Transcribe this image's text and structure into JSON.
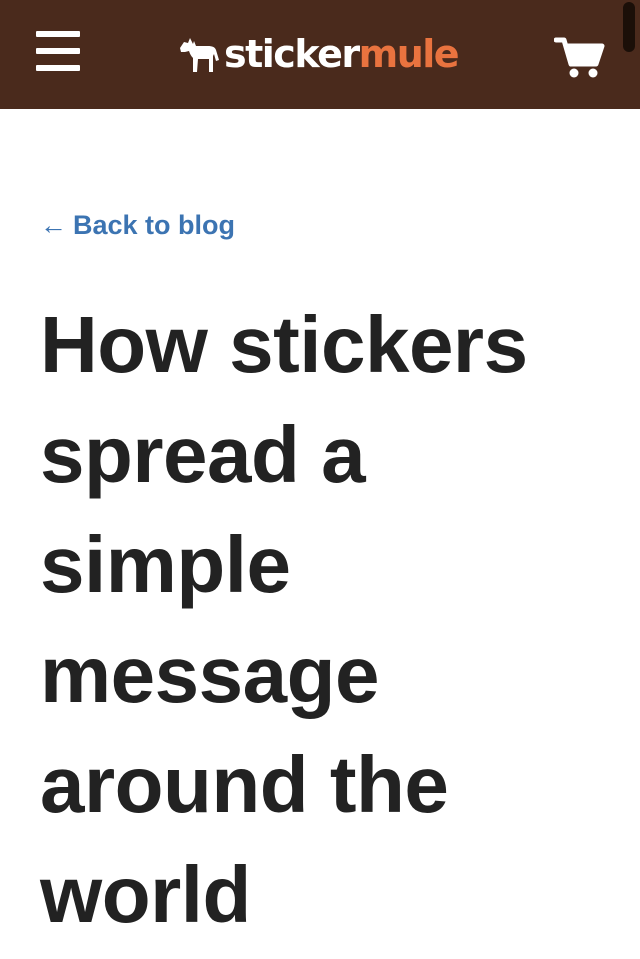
{
  "header": {
    "logo": {
      "word_white": "sticker",
      "word_orange": "mule"
    },
    "colors": {
      "background": "#4a2a1c",
      "accent": "#e9733f"
    },
    "menu_icon": "hamburger-menu-icon",
    "logo_icon": "mule-icon",
    "cart_icon": "shopping-cart-icon"
  },
  "article": {
    "back_link": {
      "arrow": "←",
      "label": "Back to blog",
      "color": "#3c74b2"
    },
    "title": "How stickers spread a simple message around the world"
  }
}
